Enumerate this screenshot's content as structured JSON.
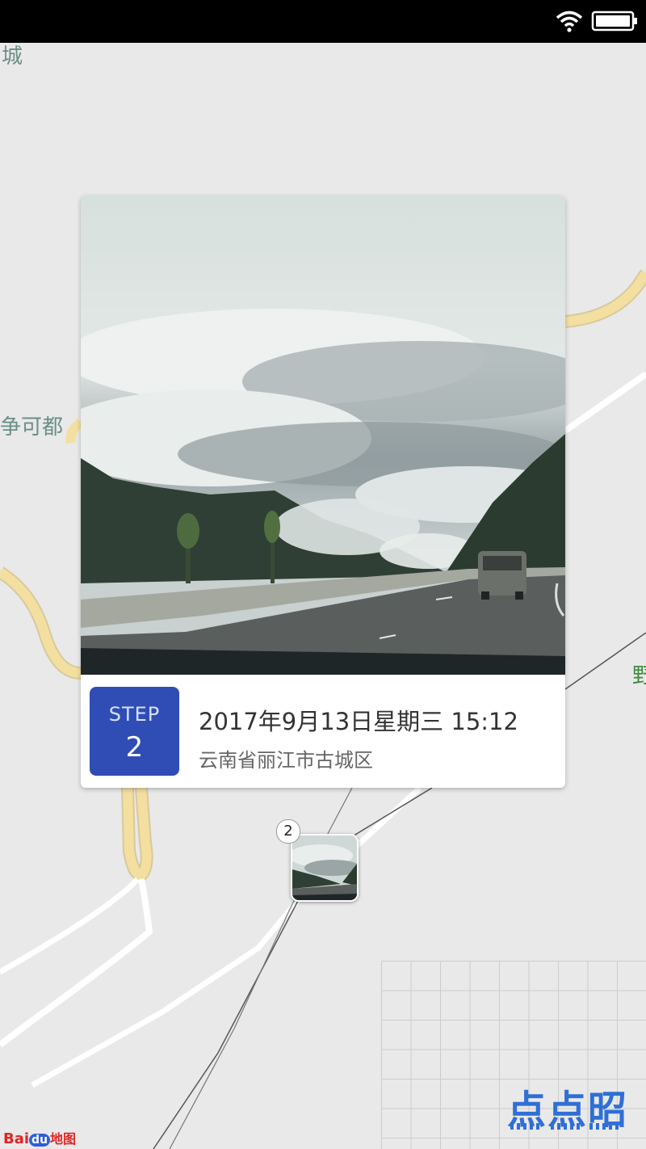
{
  "status_bar": {
    "wifi_icon": "wifi-icon",
    "battery_icon": "battery-icon"
  },
  "map": {
    "labels": {
      "top_left": "城",
      "left_middle": "争可都",
      "right_edge": "野"
    },
    "colors": {
      "background": "#e9e9e9",
      "major_road": "#f3dfa0",
      "minor_road": "#ffffff",
      "label": "#6a8f86"
    }
  },
  "card": {
    "step_label": "STEP",
    "step_number": "2",
    "date": "2017年9月13日星期三 15:12",
    "location": "云南省丽江市古城区",
    "accent_color": "#2f4db5"
  },
  "marker": {
    "count": "2"
  },
  "branding": {
    "app_logo": "点点昭",
    "baidu_logo": {
      "bai": "Bai",
      "du": "du",
      "map": "地图"
    }
  }
}
